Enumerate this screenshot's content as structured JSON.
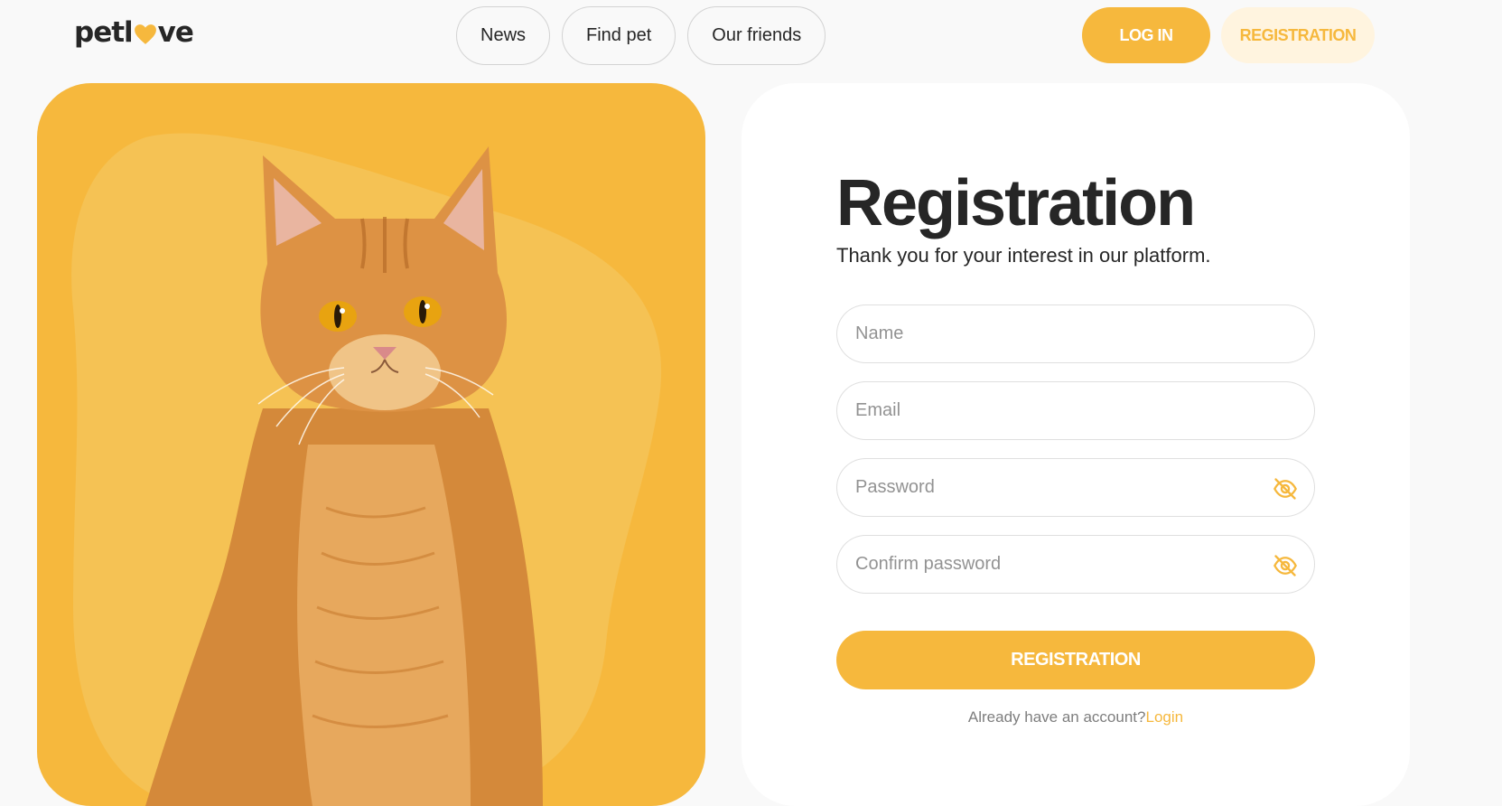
{
  "brand": {
    "logo_prefix": "petl",
    "logo_suffix": "ve",
    "accent_color": "#f6b83d",
    "accent_light": "#fff4df",
    "text_color": "#262626"
  },
  "nav": {
    "items": [
      {
        "label": "News"
      },
      {
        "label": "Find pet"
      },
      {
        "label": "Our friends"
      }
    ]
  },
  "auth": {
    "login_label": "LOG IN",
    "register_label": "REGISTRATION"
  },
  "hero": {
    "image_icon": "orange-cat-illustration"
  },
  "form": {
    "title": "Registration",
    "subtitle": "Thank you for your interest in our platform.",
    "name_placeholder": "Name",
    "email_placeholder": "Email",
    "password_placeholder": "Password",
    "confirm_placeholder": "Confirm password",
    "password_icon": "eye-off-icon",
    "submit_label": "REGISTRATION",
    "footnote_text": "Already have an account?",
    "footnote_link": "Login"
  }
}
